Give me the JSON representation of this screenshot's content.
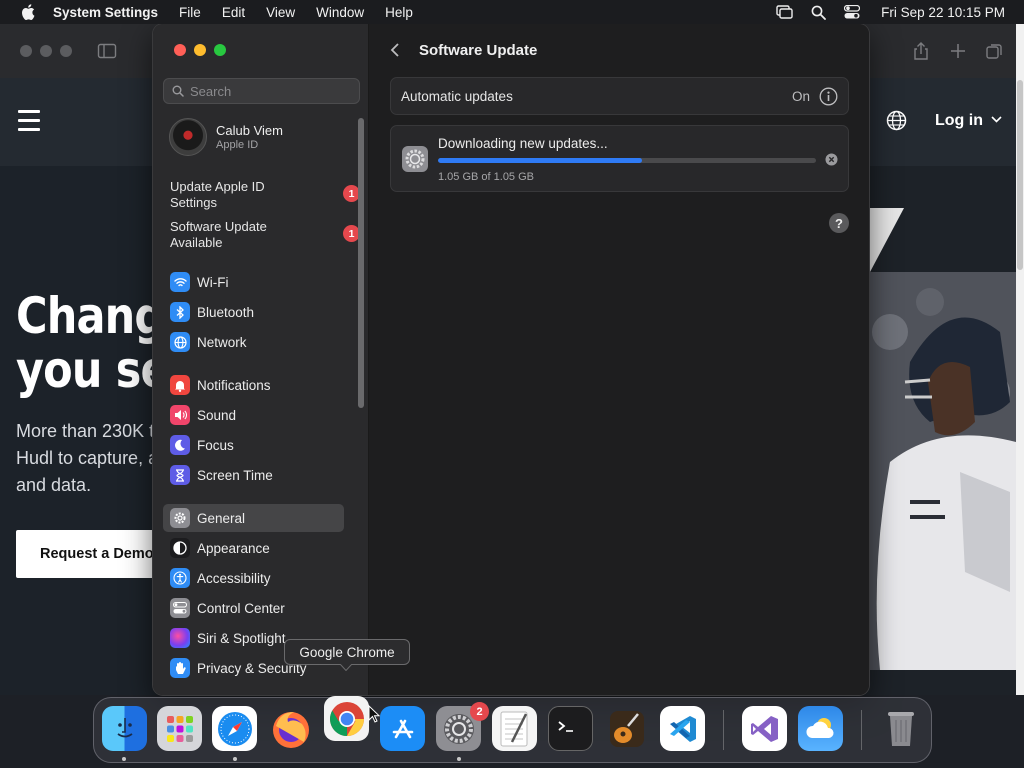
{
  "menubar": {
    "app_name": "System Settings",
    "menus": [
      "File",
      "Edit",
      "View",
      "Window",
      "Help"
    ],
    "clock": "Fri Sep 22  10:15 PM"
  },
  "browser": {
    "login": "Log in",
    "hero_title_1": "Change",
    "hero_title_2": "you se",
    "hero_text_1": "More than 230K t",
    "hero_text_2": "Hudl to capture, a",
    "hero_text_3": "and data.",
    "demo_button": "Request a Demo"
  },
  "sidebar": {
    "search_placeholder": "Search",
    "account": {
      "name": "Calub Viem",
      "subtitle": "Apple ID"
    },
    "notices": [
      {
        "line1": "Update Apple ID",
        "line2": "Settings",
        "badge": "1"
      },
      {
        "line1": "Software Update",
        "line2": "Available",
        "badge": "1"
      }
    ],
    "items": [
      {
        "label": "Wi-Fi",
        "icon": "wifi-icon",
        "color": "#2f8cf5"
      },
      {
        "label": "Bluetooth",
        "icon": "bluetooth-icon",
        "color": "#2f8cf5"
      },
      {
        "label": "Network",
        "icon": "globe-icon",
        "color": "#2f8cf5"
      },
      {
        "label": "Notifications",
        "icon": "bell-icon",
        "color": "#f0463f"
      },
      {
        "label": "Sound",
        "icon": "speaker-icon",
        "color": "#f0456a"
      },
      {
        "label": "Focus",
        "icon": "moon-icon",
        "color": "#5e5ce6"
      },
      {
        "label": "Screen Time",
        "icon": "hourglass-icon",
        "color": "#5e5ce6"
      },
      {
        "label": "General",
        "icon": "gear-icon",
        "color": "#8e8e93"
      },
      {
        "label": "Appearance",
        "icon": "appearance-icon",
        "color": "#1c1c1e"
      },
      {
        "label": "Accessibility",
        "icon": "accessibility-icon",
        "color": "#2f8cf5"
      },
      {
        "label": "Control Center",
        "icon": "toggles-icon",
        "color": "#8e8e93"
      },
      {
        "label": "Siri & Spotlight",
        "icon": "siri-icon",
        "color": "#7a3ff0"
      },
      {
        "label": "Privacy & Security",
        "icon": "hand-icon",
        "color": "#2f8cf5"
      }
    ]
  },
  "content": {
    "title": "Software Update",
    "automatic_updates_label": "Automatic updates",
    "automatic_updates_value": "On",
    "download_title": "Downloading new updates...",
    "download_size": "1.05 GB of 1.05 GB",
    "progress_fraction": 0.54,
    "help": "?"
  },
  "tooltip": "Google Chrome",
  "dock": {
    "settings_badge": "2"
  }
}
